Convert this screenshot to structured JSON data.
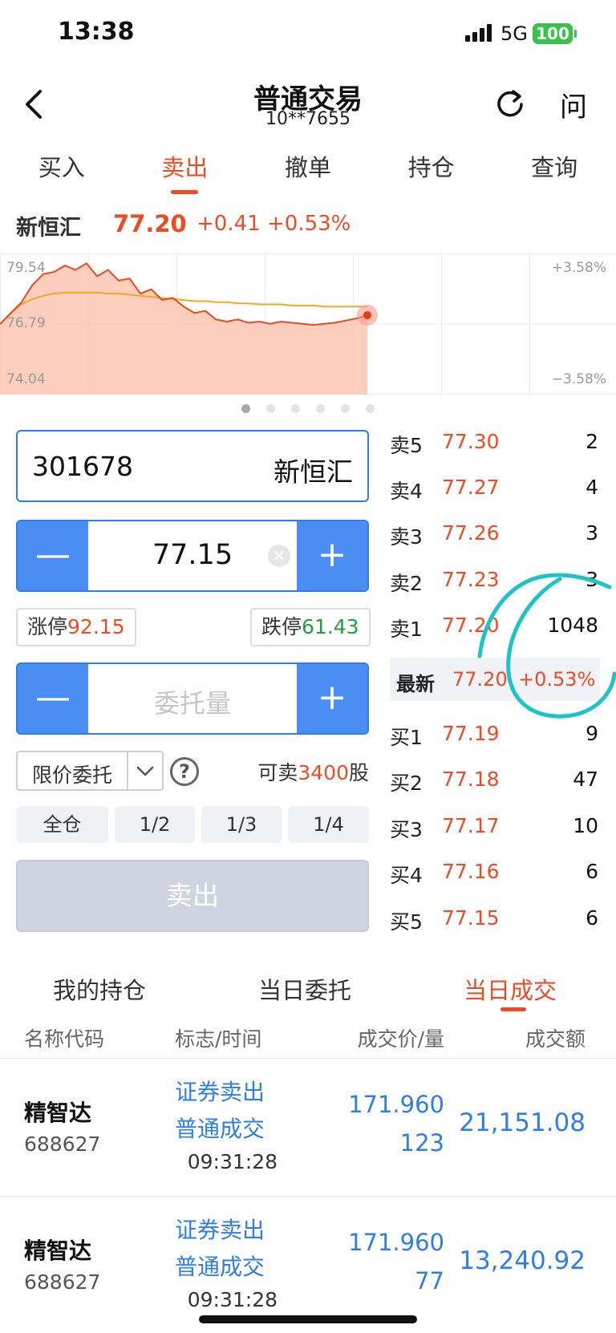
{
  "status": {
    "time": "13:38",
    "network": "5G",
    "battery": "100"
  },
  "nav": {
    "title": "普通交易",
    "account": "10**7655",
    "ask_label": "问"
  },
  "tabs": [
    {
      "label": "买入"
    },
    {
      "label": "卖出"
    },
    {
      "label": "撤单"
    },
    {
      "label": "持仓"
    },
    {
      "label": "查询"
    }
  ],
  "quote": {
    "name": "新恒汇",
    "price": "77.20",
    "change": "+0.41",
    "change_pct": "+0.53%"
  },
  "chart_data": {
    "type": "line",
    "y_labels": {
      "top": "79.54",
      "mid": "76.79",
      "bottom": "74.04"
    },
    "pct_labels": {
      "top": "+3.58%",
      "bottom": "−3.58%"
    },
    "ylim": [
      74.04,
      79.54
    ],
    "price_series": [
      76.79,
      77.3,
      77.8,
      78.6,
      79.1,
      79.2,
      79.5,
      79.3,
      79.6,
      79.0,
      79.3,
      78.8,
      78.9,
      78.2,
      78.4,
      77.9,
      78.0,
      77.6,
      77.3,
      77.4,
      77.0,
      76.9,
      77.0,
      76.85,
      76.9,
      76.8,
      76.9,
      76.85,
      76.8,
      76.75,
      76.8,
      76.85,
      76.95,
      77.05,
      77.2
    ],
    "avg_series": [
      76.79,
      77.3,
      77.7,
      77.95,
      78.1,
      78.2,
      78.25,
      78.25,
      78.25,
      78.25,
      78.2,
      78.2,
      78.15,
      78.1,
      78.05,
      78.0,
      77.95,
      77.9,
      77.85,
      77.85,
      77.8,
      77.8,
      77.75,
      77.75,
      77.7,
      77.7,
      77.7,
      77.65,
      77.65,
      77.65,
      77.6,
      77.6,
      77.6,
      77.6,
      77.6
    ],
    "grid": true
  },
  "form": {
    "stock_code": "301678",
    "stock_name": "新恒汇",
    "price": "77.15",
    "limit_up_label": "涨停",
    "limit_up": "92.15",
    "limit_down_label": "跌停",
    "limit_down": "61.43",
    "qty_placeholder": "委托量",
    "order_type": "限价委托",
    "available_label": "可卖",
    "available": "3400",
    "available_unit": "股",
    "ratios": [
      "全仓",
      "1/2",
      "1/3",
      "1/4"
    ],
    "submit": "卖出"
  },
  "order_book": {
    "asks": [
      {
        "label": "卖5",
        "price": "77.30",
        "vol": "2"
      },
      {
        "label": "卖4",
        "price": "77.27",
        "vol": "4"
      },
      {
        "label": "卖3",
        "price": "77.26",
        "vol": "3"
      },
      {
        "label": "卖2",
        "price": "77.23",
        "vol": "3"
      },
      {
        "label": "卖1",
        "price": "77.20",
        "vol": "1048"
      }
    ],
    "latest": {
      "label": "最新",
      "price": "77.20",
      "pct": "+0.53%"
    },
    "bids": [
      {
        "label": "买1",
        "price": "77.19",
        "vol": "9"
      },
      {
        "label": "买2",
        "price": "77.18",
        "vol": "47"
      },
      {
        "label": "买3",
        "price": "77.17",
        "vol": "10"
      },
      {
        "label": "买4",
        "price": "77.16",
        "vol": "6"
      },
      {
        "label": "买5",
        "price": "77.15",
        "vol": "6"
      }
    ]
  },
  "bottom_tabs": [
    "我的持仓",
    "当日委托",
    "当日成交"
  ],
  "trades": {
    "headers": [
      "名称代码",
      "标志/时间",
      "成交价/量",
      "成交额"
    ],
    "rows": [
      {
        "name": "精智达",
        "code": "688627",
        "flag1": "证券卖出",
        "flag2": "普通成交",
        "time": "09:31:28",
        "price": "171.960",
        "qty": "123",
        "amount": "21,151.08"
      },
      {
        "name": "精智达",
        "code": "688627",
        "flag1": "证券卖出",
        "flag2": "普通成交",
        "time": "09:31:28",
        "price": "171.960",
        "qty": "77",
        "amount": "13,240.92"
      }
    ]
  },
  "colors": {
    "accent": "#f04a23",
    "blue": "#2d7ee6",
    "stepper": "#4a8ef3",
    "annotation": "#1ec3c8"
  },
  "icons": [
    "back-arrow-icon",
    "refresh-icon",
    "clear-icon",
    "chevron-down-icon",
    "help-icon"
  ]
}
